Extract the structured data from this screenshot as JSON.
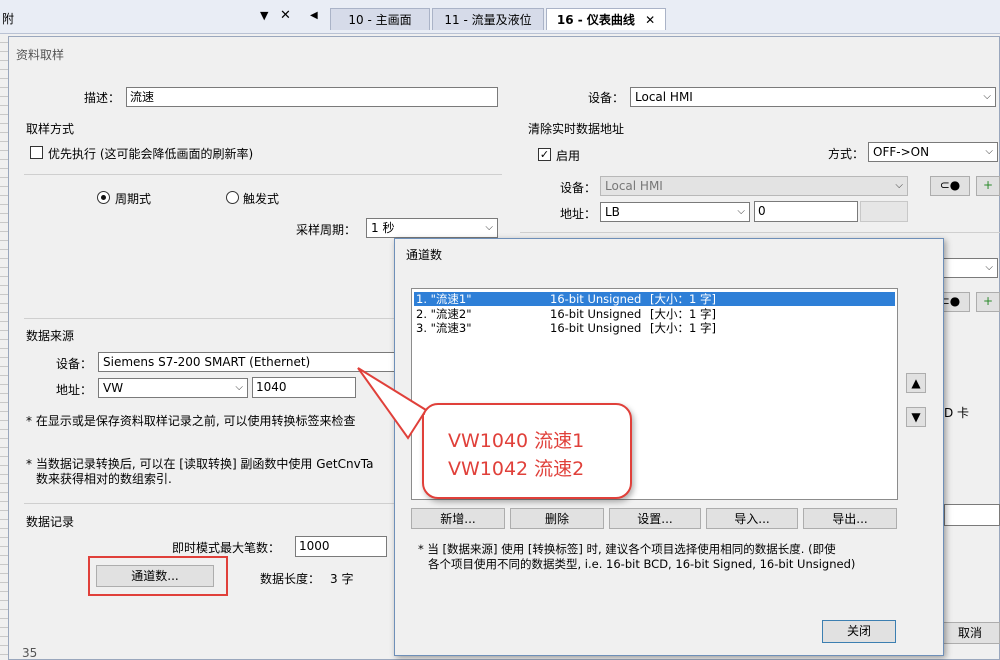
{
  "top_panel": {
    "title_fragment": "附",
    "pin": "▼",
    "close": "✕"
  },
  "tabs": [
    {
      "label": "10 - 主画面"
    },
    {
      "label": "11 - 流量及液位"
    },
    {
      "label": "16 - 仪表曲线"
    }
  ],
  "tab_close": "✕",
  "tab_scroll_left": "◀",
  "main_dialog": {
    "title": "资料取样",
    "description_label": "描述：",
    "description_value": "流速",
    "device_label": "设备：",
    "device_value": "Local HMI",
    "sampling_mode_title": "取样方式",
    "priority_label": "优先执行 (这可能会降低画面的刷新率)",
    "periodic_label": "周期式",
    "trigger_label": "触发式",
    "period_label": "采样周期：",
    "period_value": "1 秒",
    "clear_title": "清除实时数据地址",
    "enable_label": "启用",
    "mode_label": "方式：",
    "mode_value": "OFF->ON",
    "clear_device_label": "设备：",
    "clear_device_value": "Local HMI",
    "clear_address_label": "地址：",
    "clear_address_type": "LB",
    "clear_address_value": "0",
    "source_title": "数据来源",
    "source_device_label": "设备：",
    "source_device_value": "Siemens S7-200 SMART (Ethernet)",
    "source_address_label": "地址：",
    "source_address_type": "VW",
    "source_address_value": "1040",
    "note1": "* 在显示或是保存资料取样记录之前, 可以使用转换标签来检查",
    "note2_line1": "* 当数据记录转换后, 可以在 [读取转换] 副函数中使用 GetCnvTa",
    "note2_line2": "数来获得相对的数组索引.",
    "record_title": "数据记录",
    "max_count_label": "即时模式最大笔数：",
    "max_count_value": "1000",
    "channels_button": "通道数...",
    "data_length_label": "数据长度：",
    "data_length_value": "3 字",
    "cancel_button": "取消",
    "right_fragment_text": "D 卡",
    "bottom_number": "35"
  },
  "channel_dialog": {
    "title": "通道数",
    "rows": [
      {
        "name": "1. \"流速1\"",
        "type": "16-bit Unsigned",
        "size": "[大小：1 字]"
      },
      {
        "name": "2. \"流速2\"",
        "type": "16-bit Unsigned",
        "size": "[大小：1 字]"
      },
      {
        "name": "3. \"流速3\"",
        "type": "16-bit Unsigned",
        "size": "[大小：1 字]"
      }
    ],
    "buttons": {
      "add": "新增...",
      "delete": "删除",
      "settings": "设置...",
      "import": "导入...",
      "export": "导出..."
    },
    "note_line1": "* 当 [数据来源] 使用 [转换标签] 时, 建议各个项目选择使用相同的数据长度. (即使",
    "note_line2": "各个项目使用不同的数据类型, i.e. 16-bit BCD, 16-bit Signed, 16-bit Unsigned)",
    "close_button": "关闭",
    "up_arrow": "▲",
    "down_arrow": "▼"
  },
  "callout": {
    "line1": "VW1040  流速1",
    "line2": "VW1042  流速2",
    "color": "#e0403a"
  },
  "colors": {
    "highlight_red": "#e0403a",
    "selection_blue": "#2e7fd7",
    "dialog_border": "#6e8fb8"
  }
}
